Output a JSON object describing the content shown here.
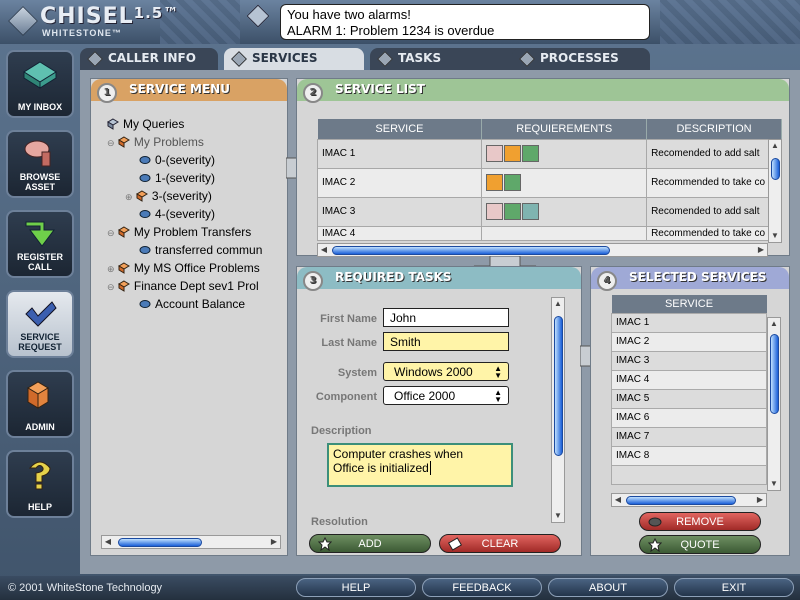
{
  "app": {
    "logo_name": "CHISEL",
    "logo_version": "1.5",
    "logo_tm": "™",
    "logo_company": "WHITESTONE",
    "logo_company_tm": "™"
  },
  "alarm": {
    "line1": "You have two alarms!",
    "line2": "ALARM 1: Problem 1234 is overdue"
  },
  "sidebar": {
    "items": [
      {
        "label": "MY INBOX"
      },
      {
        "label": "BROWSE",
        "label2": "ASSET"
      },
      {
        "label": "REGISTER",
        "label2": "CALL"
      },
      {
        "label": "SERVICE",
        "label2": "REQUEST"
      },
      {
        "label": "ADMIN"
      },
      {
        "label": "HELP"
      }
    ]
  },
  "tabs": [
    {
      "label": "CALLER INFO"
    },
    {
      "label": "SERVICES"
    },
    {
      "label": "TASKS"
    },
    {
      "label": "PROCESSES"
    }
  ],
  "service_menu": {
    "number": "1",
    "title": "SERVICE MENU",
    "tree": [
      {
        "label": "My Queries"
      },
      {
        "label": "My Problems"
      },
      {
        "label": "0-(severity)"
      },
      {
        "label": "1-(severity)"
      },
      {
        "label": "3-(severity)"
      },
      {
        "label": "4-(severity)"
      },
      {
        "label": "My Problem Transfers"
      },
      {
        "label": "transferred commun"
      },
      {
        "label": "My MS Office Problems"
      },
      {
        "label": "Finance Dept sev1 Prol"
      },
      {
        "label": "Account Balance"
      }
    ]
  },
  "service_list": {
    "number": "2",
    "title": "SERVICE LIST",
    "columns": [
      "SERVICE",
      "REQUIEREMENTS",
      "DESCRIPTION"
    ],
    "rows": [
      {
        "service": "IMAC 1",
        "description": "Recomended to add salt"
      },
      {
        "service": "IMAC 2",
        "description": "Recommended to take co"
      },
      {
        "service": "IMAC 3",
        "description": "Recomended to add salt"
      },
      {
        "service": "IMAC 4",
        "description": "Recommended to take co"
      }
    ]
  },
  "required_tasks": {
    "number": "3",
    "title": "REQUIRED TASKS",
    "first_name_label": "First Name",
    "first_name": "John",
    "last_name_label": "Last Name",
    "last_name": "Smith",
    "system_label": "System",
    "system": "Windows 2000",
    "component_label": "Component",
    "component": "Office 2000",
    "description_label": "Description",
    "description_line1": "Computer crashes when",
    "description_line2": "Office is initialized",
    "resolution_label": "Resolution",
    "add_label": "ADD",
    "clear_label": "CLEAR"
  },
  "selected_services": {
    "number": "4",
    "title": "SELECTED SERVICES",
    "column": "SERVICE",
    "rows": [
      "IMAC 1",
      "IMAC 2",
      "IMAC 3",
      "IMAC 4",
      "IMAC 5",
      "IMAC 6",
      "IMAC 7",
      "IMAC 8"
    ],
    "remove_label": "REMOVE",
    "quote_label": "QUOTE"
  },
  "footer": {
    "copyright": "© 2001 WhiteStone Technology",
    "help": "HELP",
    "feedback": "FEEDBACK",
    "about": "ABOUT",
    "exit": "EXIT"
  },
  "colors": {
    "service_menu_header": "#d9a264",
    "service_list_header": "#9ec596",
    "required_tasks_header": "#8dbcc4",
    "selected_services_header": "#9fa9d6",
    "accent_blue": "#1a5fd8"
  }
}
